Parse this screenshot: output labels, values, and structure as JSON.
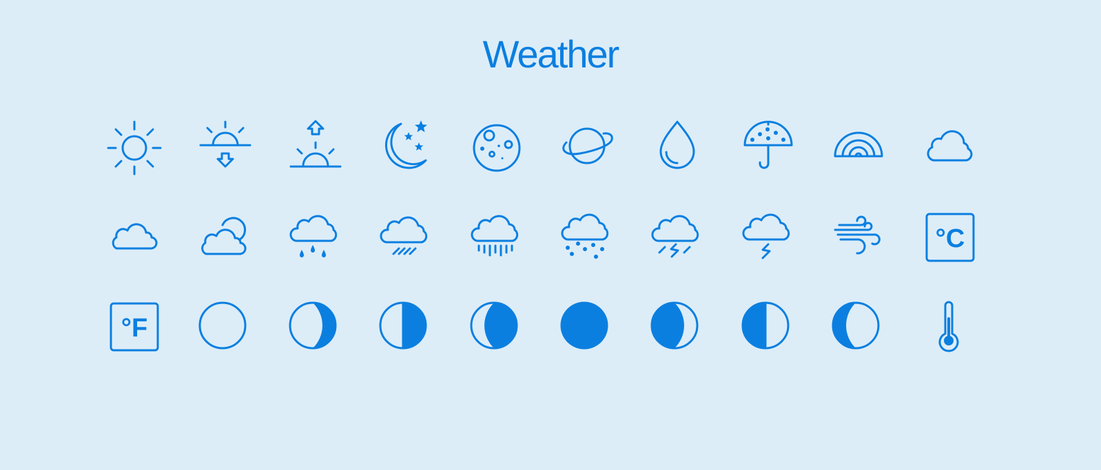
{
  "title": "Weather",
  "accent_color": "#0b7fe0",
  "background_color": "#dcedf8",
  "icons": [
    {
      "name": "sun-icon"
    },
    {
      "name": "sunset-icon"
    },
    {
      "name": "sunrise-icon"
    },
    {
      "name": "moon-stars-icon"
    },
    {
      "name": "full-moon-craters-icon"
    },
    {
      "name": "planet-icon"
    },
    {
      "name": "raindrop-icon"
    },
    {
      "name": "umbrella-icon"
    },
    {
      "name": "rainbow-icon"
    },
    {
      "name": "cloud-icon"
    },
    {
      "name": "cloud-small-icon"
    },
    {
      "name": "cloudy-moon-icon"
    },
    {
      "name": "cloud-drizzle-icon"
    },
    {
      "name": "cloud-heavy-rain-icon"
    },
    {
      "name": "cloud-rain-icon"
    },
    {
      "name": "cloud-snow-icon"
    },
    {
      "name": "cloud-thunder-rain-icon"
    },
    {
      "name": "cloud-lightning-icon"
    },
    {
      "name": "wind-icon"
    },
    {
      "name": "celsius-icon",
      "label": "°C"
    },
    {
      "name": "fahrenheit-icon",
      "label": "°F"
    },
    {
      "name": "new-moon-icon"
    },
    {
      "name": "waxing-crescent-icon"
    },
    {
      "name": "first-quarter-icon"
    },
    {
      "name": "waxing-gibbous-icon"
    },
    {
      "name": "full-moon-icon"
    },
    {
      "name": "waning-gibbous-icon"
    },
    {
      "name": "last-quarter-icon"
    },
    {
      "name": "waning-crescent-icon"
    },
    {
      "name": "thermometer-icon"
    }
  ]
}
